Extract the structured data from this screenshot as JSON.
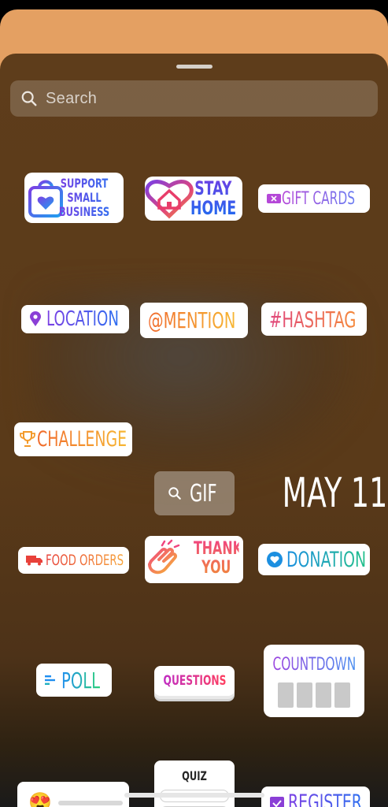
{
  "search": {
    "placeholder": "Search"
  },
  "stickers": {
    "support_small_business": [
      "SUPPORT",
      "SMALL",
      "BUSINESS"
    ],
    "stay_home": [
      "STAY",
      "HOME"
    ],
    "gift_cards": "GIFT CARDS",
    "location": "LOCATION",
    "mention": "@MENTION",
    "hashtag": "#HASHTAG",
    "challenge": "CHALLENGE",
    "gif": "GIF",
    "date": "MAY 11",
    "food_orders": "FOOD ORDERS",
    "thank_you": [
      "THANK",
      "YOU"
    ],
    "donation": "DONATION",
    "poll": "POLL",
    "questions": "QUESTIONS",
    "countdown": "COUNTDOWN",
    "quiz": "QUIZ",
    "register": "REGISTER",
    "emoji_slider_emoji": "😍"
  },
  "colors": {
    "top_card": "#e4a062",
    "sheet_bg": "#5e3d1b"
  }
}
